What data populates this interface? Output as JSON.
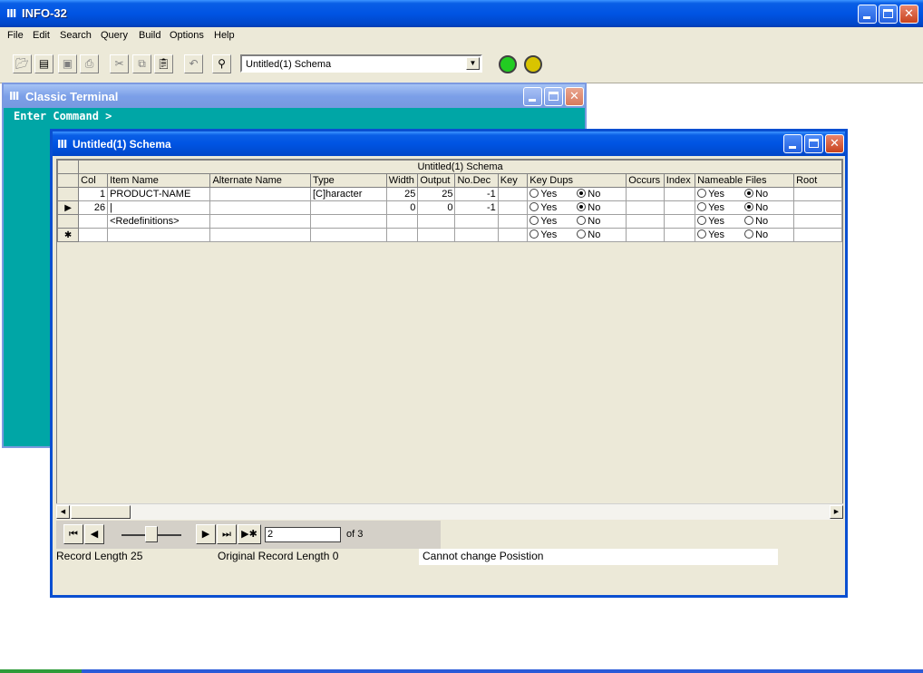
{
  "app": {
    "title": "INFO-32",
    "icon": "Ⅲ",
    "menu": [
      "File",
      "Edit",
      "Search",
      "Query",
      "Build",
      "Options",
      "Help"
    ],
    "toolbar": {
      "schema_selector": "Untitled(1) Schema",
      "buttons": [
        "open-icon",
        "new-icon",
        "save-icon",
        "print-icon",
        "cut-icon",
        "copy-icon",
        "paste-icon",
        "undo-icon",
        "find-icon"
      ],
      "status_lights": [
        "#22cc22",
        "#d8c400"
      ]
    }
  },
  "terminal": {
    "title": "Classic Terminal",
    "prompt": "Enter Command >"
  },
  "schema": {
    "title": "Untitled(1) Schema",
    "grid_title": "Untitled(1) Schema",
    "columns": [
      "Col",
      "Item Name",
      "Alternate Name",
      "Type",
      "Width",
      "Output",
      "No.Dec",
      "Key",
      "Key Dups",
      "Occurs",
      "Index",
      "Nameable Files",
      "Root"
    ],
    "radio_yes": "Yes",
    "radio_no": "No",
    "rows": [
      {
        "marker": "",
        "col": "1",
        "item_name": "PRODUCT-NAME",
        "alt_name": "",
        "type": "[C]haracter",
        "width": "25",
        "output": "25",
        "no_dec": "-1",
        "key": "",
        "key_dups": "No",
        "occurs": "",
        "index": "",
        "nameable": "No",
        "root": ""
      },
      {
        "marker": "▶",
        "col": "26",
        "item_name": "|",
        "alt_name": "",
        "type": "",
        "width": "0",
        "output": "0",
        "no_dec": "-1",
        "key": "",
        "key_dups": "No",
        "occurs": "",
        "index": "",
        "nameable": "No",
        "root": ""
      },
      {
        "marker": "",
        "col": "",
        "item_name": "<Redefinitions>",
        "alt_name": "",
        "type": "",
        "width": "",
        "output": "",
        "no_dec": "",
        "key": "",
        "key_dups": "",
        "occurs": "",
        "index": "",
        "nameable": "",
        "root": ""
      },
      {
        "marker": "✱",
        "col": "",
        "item_name": "",
        "alt_name": "",
        "type": "",
        "width": "",
        "output": "",
        "no_dec": "",
        "key": "",
        "key_dups": "",
        "occurs": "",
        "index": "",
        "nameable": "",
        "root": ""
      }
    ],
    "navigator": {
      "record": "2",
      "of_label": "of 3"
    },
    "status": {
      "record_length": "Record Length 25",
      "original_record_length": "Original Record Length 0",
      "message": "Cannot change Posistion"
    }
  }
}
